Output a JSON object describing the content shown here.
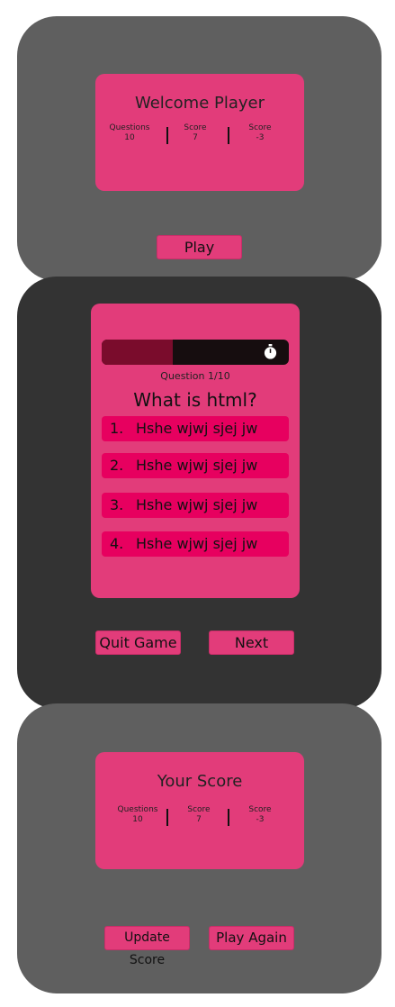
{
  "welcome_screen": {
    "title": "Welcome Player",
    "stats": [
      {
        "label": "Questions",
        "value": "10"
      },
      {
        "label": "Score",
        "value": "7"
      },
      {
        "label": "Score",
        "value": "-3"
      }
    ],
    "play_label": "Play"
  },
  "quiz_screen": {
    "timer_progress": 0.38,
    "question_counter": "Question 1/10",
    "question": "What is html?",
    "options": [
      {
        "number": "1.",
        "text": "Hshe wjwj sjej jw"
      },
      {
        "number": "2.",
        "text": "Hshe wjwj sjej jw"
      },
      {
        "number": "3.",
        "text": "Hshe wjwj sjej jw"
      },
      {
        "number": "4.",
        "text": "Hshe wjwj sjej jw"
      }
    ],
    "quit_label": "Quit Game",
    "next_label": "Next"
  },
  "score_screen": {
    "title": "Your Score",
    "stats": [
      {
        "label": "Questions",
        "value": "10"
      },
      {
        "label": "Score",
        "value": "7"
      },
      {
        "label": "Score",
        "value": "-3"
      }
    ],
    "update_label": "Update Score",
    "play_again_label": "Play Again"
  },
  "colors": {
    "accent": "#e23c7a",
    "option": "#e7005f",
    "panel_light": "#5f5f5f",
    "panel_dark": "#333333",
    "timer_track": "#160d0f",
    "timer_fill": "#7a0c2c"
  },
  "icons": {
    "timer": "stopwatch-icon"
  }
}
